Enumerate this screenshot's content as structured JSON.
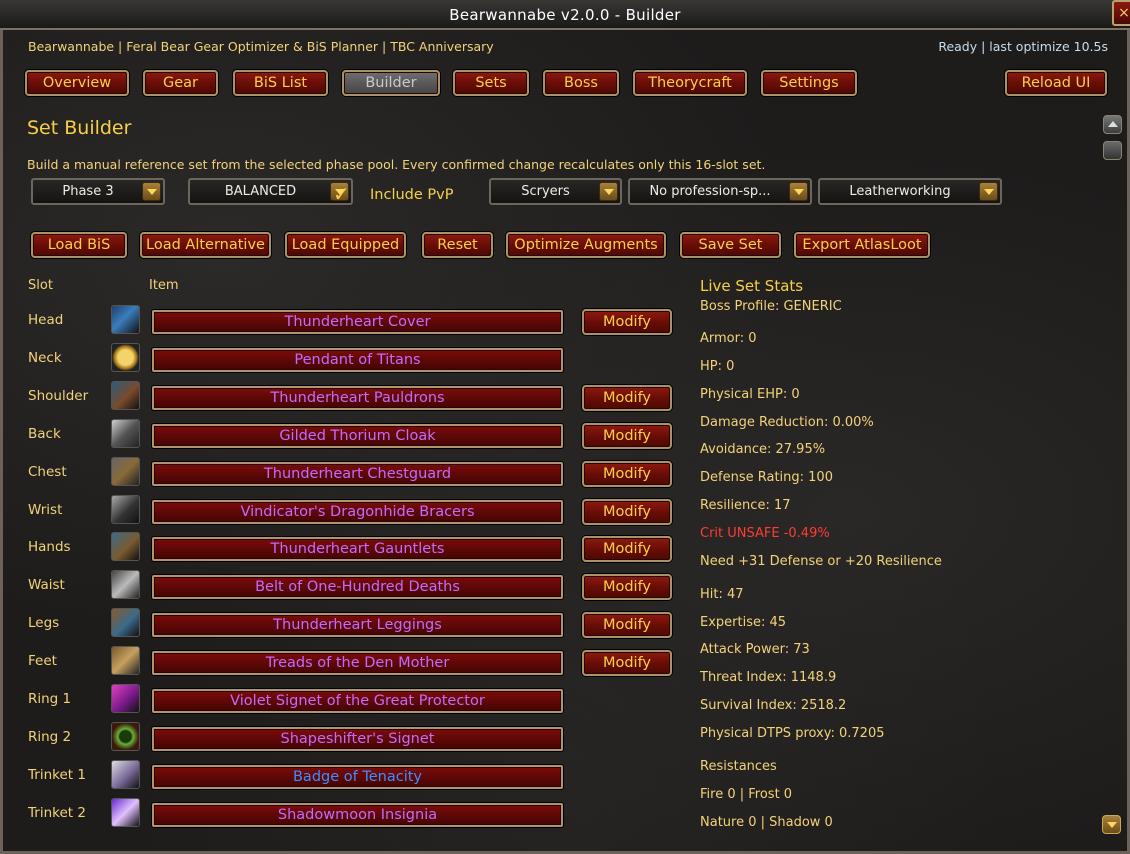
{
  "window": {
    "title": "Bearwannabe v2.0.0  -  Builder",
    "close": "×"
  },
  "header": {
    "subtitle": "Bearwannabe | Feral Bear Gear Optimizer & BiS Planner | TBC Anniversary",
    "status": "Ready | last optimize 10.5s"
  },
  "nav": {
    "tabs": [
      {
        "label": "Overview"
      },
      {
        "label": "Gear"
      },
      {
        "label": "BiS List"
      },
      {
        "label": "Builder",
        "active": true
      },
      {
        "label": "Sets"
      },
      {
        "label": "Boss"
      },
      {
        "label": "Theorycraft"
      },
      {
        "label": "Settings"
      }
    ],
    "reload": "Reload UI"
  },
  "builder": {
    "title": "Set Builder",
    "description": "Build a manual reference set from the selected phase pool. Every confirmed change recalculates only this 16-slot set.",
    "filters": {
      "phase": "Phase 3",
      "mode": "BALANCED",
      "include_pvp": "Include PvP",
      "include_pvp_checked": true,
      "faction": "Scryers",
      "profession1": "No profession-sp...",
      "profession2": "Leatherworking"
    },
    "actions": [
      "Load BiS",
      "Load Alternative",
      "Load Equipped",
      "Reset",
      "Optimize Augments",
      "Save Set",
      "Export AtlasLoot"
    ],
    "columns": {
      "slot": "Slot",
      "item": "Item"
    },
    "modify_label": "Modify",
    "slots": [
      {
        "slot": "Head",
        "item": "Thunderheart Cover",
        "quality": "epic",
        "modify": true,
        "icon": "helm-icon"
      },
      {
        "slot": "Neck",
        "item": "Pendant of Titans",
        "quality": "epic",
        "modify": false,
        "icon": "amulet-icon"
      },
      {
        "slot": "Shoulder",
        "item": "Thunderheart Pauldrons",
        "quality": "epic",
        "modify": true,
        "icon": "shoulder-icon"
      },
      {
        "slot": "Back",
        "item": "Gilded Thorium Cloak",
        "quality": "epic",
        "modify": true,
        "icon": "cloak-icon"
      },
      {
        "slot": "Chest",
        "item": "Thunderheart Chestguard",
        "quality": "epic",
        "modify": true,
        "icon": "chest-icon"
      },
      {
        "slot": "Wrist",
        "item": "Vindicator's Dragonhide Bracers",
        "quality": "epic",
        "modify": true,
        "icon": "bracer-icon"
      },
      {
        "slot": "Hands",
        "item": "Thunderheart Gauntlets",
        "quality": "epic",
        "modify": true,
        "icon": "gloves-icon"
      },
      {
        "slot": "Waist",
        "item": "Belt of One-Hundred Deaths",
        "quality": "epic",
        "modify": true,
        "icon": "belt-icon"
      },
      {
        "slot": "Legs",
        "item": "Thunderheart Leggings",
        "quality": "epic",
        "modify": true,
        "icon": "legs-icon"
      },
      {
        "slot": "Feet",
        "item": "Treads of the Den Mother",
        "quality": "epic",
        "modify": true,
        "icon": "boots-icon"
      },
      {
        "slot": "Ring 1",
        "item": "Violet Signet of the Great Protector",
        "quality": "epic",
        "modify": false,
        "icon": "ring-icon"
      },
      {
        "slot": "Ring 2",
        "item": "Shapeshifter's Signet",
        "quality": "epic",
        "modify": false,
        "icon": "ring-icon"
      },
      {
        "slot": "Trinket 1",
        "item": "Badge of Tenacity",
        "quality": "rare",
        "modify": false,
        "icon": "badge-icon"
      },
      {
        "slot": "Trinket 2",
        "item": "Shadowmoon Insignia",
        "quality": "epic",
        "modify": false,
        "icon": "crystal-icon"
      }
    ]
  },
  "stats": {
    "title": "Live Set Stats",
    "items": [
      {
        "text": "Boss Profile: GENERIC"
      },
      {
        "text": "Armor: 0"
      },
      {
        "text": "HP: 0"
      },
      {
        "text": "Physical EHP: 0"
      },
      {
        "text": "Damage Reduction: 0.00%"
      },
      {
        "text": "Avoidance: 27.95%"
      },
      {
        "text": "Defense Rating: 100"
      },
      {
        "text": "Resilience: 17"
      },
      {
        "text": "Crit UNSAFE -0.49%",
        "warn": true
      },
      {
        "text": "Need +31 Defense or +20 Resilience"
      },
      {
        "text": "Hit: 47"
      },
      {
        "text": "Expertise: 45"
      },
      {
        "text": "Attack Power: 73"
      },
      {
        "text": "Threat Index: 1148.9"
      },
      {
        "text": "Survival Index: 2518.2"
      },
      {
        "text": "Physical DTPS proxy: 0.7205"
      },
      {
        "text": "Resistances"
      },
      {
        "text": "Fire 0 | Frost 0"
      },
      {
        "text": "Nature 0 | Shadow 0"
      }
    ]
  },
  "colors": {
    "gold": "#f8d048",
    "epic": "#c06bff",
    "rare": "#3c8fff",
    "warning": "#ff3b33",
    "button_red": "#6a0d07"
  }
}
